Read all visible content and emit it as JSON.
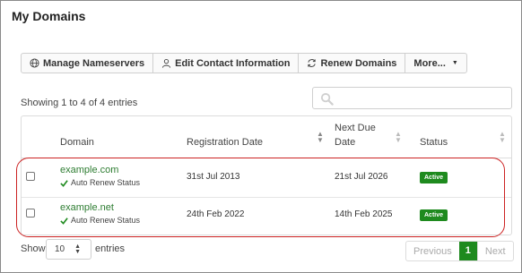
{
  "page_title": "My Domains",
  "toolbar": {
    "manage_nameservers": "Manage Nameservers",
    "edit_contact": "Edit Contact Information",
    "renew_domains": "Renew Domains",
    "more": "More...",
    "more_caret": "▼"
  },
  "showing_text": "Showing 1 to 4 of 4 entries",
  "search": {
    "placeholder": ""
  },
  "table": {
    "headers": {
      "domain": "Domain",
      "registration_date": "Registration Date",
      "next_due_date_line1": "Next Due",
      "next_due_date_line2": "Date",
      "status": "Status"
    },
    "rows": [
      {
        "domain": "example.com",
        "auto_renew": "Auto Renew Status",
        "registration_date": "31st Jul 2013",
        "next_due_date": "21st Jul 2026",
        "status": "Active"
      },
      {
        "domain": "example.net",
        "auto_renew": "Auto Renew Status",
        "registration_date": "24th Feb 2022",
        "next_due_date": "14th Feb 2025",
        "status": "Active"
      }
    ]
  },
  "length": {
    "show_label": "Show",
    "value": "10",
    "entries_label": "entries"
  },
  "pagination": {
    "previous": "Previous",
    "current": "1",
    "next": "Next"
  },
  "colors": {
    "accent_green": "#1e8a1e",
    "link_green": "#2e7d32",
    "highlight_red": "#cc2222"
  }
}
